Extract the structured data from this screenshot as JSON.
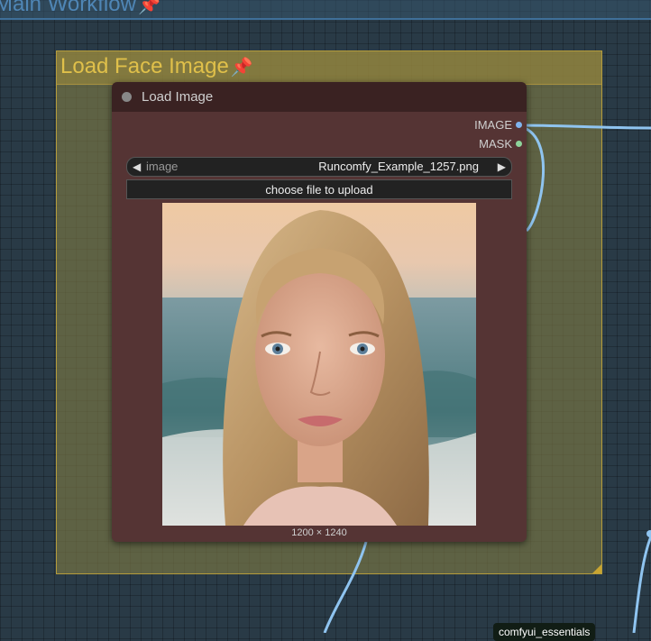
{
  "outer_group": {
    "title": "Main Workflow",
    "pin_icon": "pushpin-icon"
  },
  "group": {
    "title": "Load Face Image",
    "pin_icon": "pushpin-icon",
    "color": "#b59c3c"
  },
  "node": {
    "title": "Load Image",
    "outputs": [
      {
        "label": "IMAGE",
        "color": "#7fb4ee"
      },
      {
        "label": "MASK",
        "color": "#8ed49b"
      }
    ],
    "combo": {
      "label": "image",
      "value": "Runcomfy_Example_1257.png"
    },
    "upload_button_label": "choose file to upload",
    "dimensions": "1200 × 1240"
  },
  "badge": {
    "label": "comfyui_essentials"
  },
  "colors": {
    "wire": "#8fc4f0",
    "node_body": "#553434",
    "node_title": "#3a2222"
  }
}
